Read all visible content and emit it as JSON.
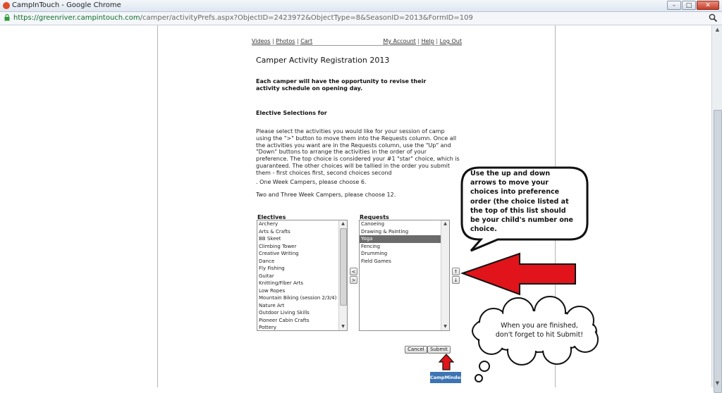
{
  "browser": {
    "window_title": "CampInTouch - Google Chrome",
    "url_scheme": "https://",
    "url_host": "greenriver.campintouch.com",
    "url_path": "/camper/activityPrefs.aspx?ObjectID=2423972&ObjectType=8&SeasonID=2013&FormID=109",
    "favicon_icon": "campintouch-favicon-icon",
    "lock_icon": "lock-icon",
    "zoom_icon": "magnifier-icon"
  },
  "topnav": {
    "left_links": [
      "Videos",
      "Photos",
      "Cart"
    ],
    "right_links": [
      "My Account",
      "Help",
      "Log Out"
    ],
    "separator": "|"
  },
  "page": {
    "title": "Camper Activity Registration 2013",
    "notice": "Each camper will have the opportunity to revise their activity schedule on opening day.",
    "elective_heading": "Elective Selections for",
    "instructions": "Please select the activities you would like for your session of camp using the \">\" button to move them into the Requests column. Once all the activities you want are in the Requests column, use the \"Up\" and \"Down\" buttons to arrange the activities in the order of your preference. The top choice is considered your #1 \"star\" choice, which is guaranteed. The other choices will be tallied in the order you submit them - first choices first, second choices second",
    "line_one_week": ". One Week Campers, please choose 6.",
    "line_two_three_week": "Two and Three Week Campers, please choose 12."
  },
  "electives": {
    "label": "Electives",
    "items": [
      "Archery",
      "Arts & Crafts",
      "BB Skeet",
      "Climbing Tower",
      "Creative Writing",
      "Dance",
      "Fly Fishing",
      "Guitar",
      "Knitting/Fiber Arts",
      "Low Ropes",
      "Mountain Biking (session 2/3/4)",
      "Nature Art",
      "Outdoor Living Skills",
      "Pioneer Cabin Crafts",
      "Pottery"
    ]
  },
  "requests": {
    "label": "Requests",
    "items": [
      "Canoeing",
      "Drawing & Painting",
      "Yoga",
      "Fencing",
      "Drumming",
      "Field Games"
    ],
    "selected": "Yoga"
  },
  "move_buttons": {
    "remove_label": "<",
    "add_label": ">",
    "up_label": "↑",
    "down_label": "↓"
  },
  "form_buttons": {
    "cancel_label": "Cancel",
    "submit_label": "Submit"
  },
  "logo_text": "CampMinder",
  "annotations": {
    "callout": "Use the up and down arrows to move your choices into preference order (the choice listed at the top of this list should be your child's number one choice.",
    "thought": "When you are finished, don't forget to hit Submit!",
    "arrow_color": "#e0141a"
  },
  "colors": {
    "selected_row": "#6b6b6b",
    "link_host": "#0b6e2a"
  }
}
